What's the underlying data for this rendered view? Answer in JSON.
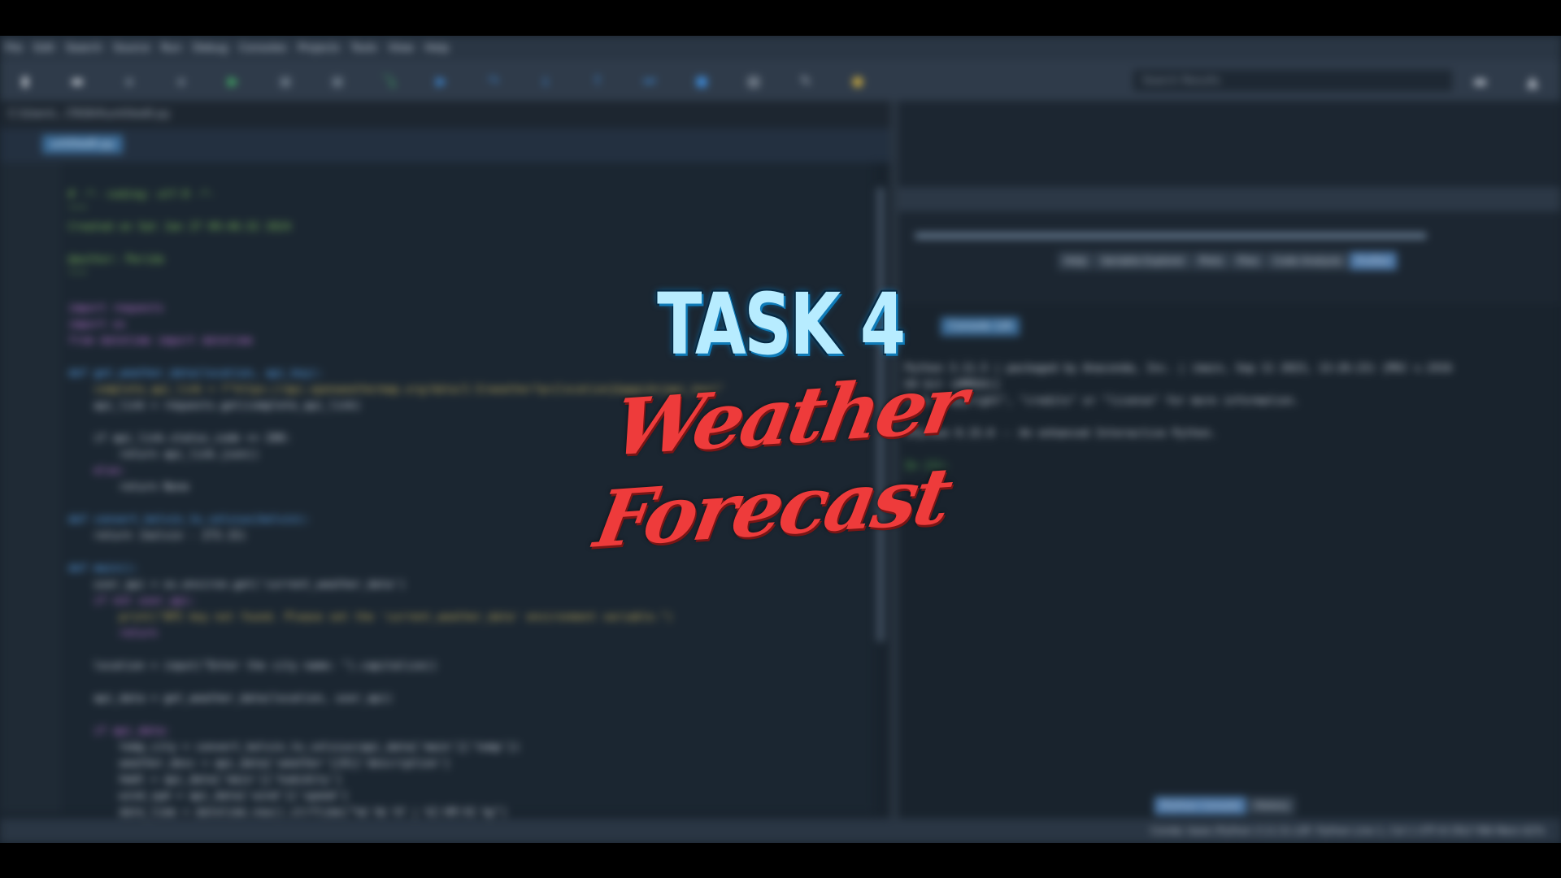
{
  "overlay": {
    "title": "TASK 4",
    "subtitle": "Weather Forecast"
  },
  "ide": {
    "menu": [
      "File",
      "Edit",
      "Search",
      "Source",
      "Run",
      "Debug",
      "Consoles",
      "Projects",
      "Tools",
      "View",
      "Help"
    ],
    "search_placeholder": "Search Results",
    "path": "C:\\Users\\...\\TASK4\\untitled0.py",
    "editor_tab": "untitled0.py",
    "code": [
      "# -*- coding: utf-8 -*-",
      "\"\"\"",
      "Created on Sat Jan 27 09:46:32 2024",
      "",
      "@author: Parida",
      "\"\"\"",
      "",
      "import requests",
      "import os",
      "from datetime import datetime",
      "",
      "def get_weather_data(location, api_key):",
      "    complete_api_link = f\"https://api.openweathermap.org/data/2.5/weather?q={location}&appid={api_key}\"",
      "    api_link = requests.get(complete_api_link)",
      "",
      "    if api_link.status_code == 200:",
      "        return api_link.json()",
      "    else:",
      "        return None",
      "",
      "def convert_kelvin_to_celsius(kelvin):",
      "    return (kelvin - 273.15)",
      "",
      "def main():",
      "    user_api = os.environ.get('current_weather_data')",
      "    if not user_api:",
      "        print(\"API key not found. Please set the 'current_weather_data' environment variable.\")",
      "        return",
      "",
      "    location = input(\"Enter the city name: \").capitalize()",
      "",
      "    api_data = get_weather_data(location, user_api)",
      "",
      "    if api_data:",
      "        temp_city = convert_kelvin_to_celsius(api_data['main']['temp'])",
      "        weather_desc = api_data['weather'][0]['description']",
      "        hmdt = api_data['main']['humidity']",
      "        wind_spd = api_data['wind']['speed']",
      "        date_time = datetime.now().strftime(\"%d %b %Y | %I:%M:%S %p\")"
    ],
    "pane_tabs": [
      "Help",
      "Variable Explorer",
      "Plots",
      "Files",
      "Code Analysis",
      "Profiler"
    ],
    "console_tab": "Console 1/A",
    "console_text": [
      "Python 3.11.5 | packaged by Anaconda, Inc. | (main, Sep 11 2023, 13:26:23) [MSC v.1916",
      "64 bit (AMD64)]",
      "Type \"copyright\", \"credits\" or \"license\" for more information.",
      "",
      "IPython 8.15.0 -- An enhanced Interactive Python.",
      "",
      "In [1]:"
    ],
    "console_bottom_tabs": [
      "IPython Console",
      "History"
    ],
    "status": "Conda: base (Python 3.11.5)   LSP: Python   Line 1, Col 1   UTF-8   CRLF   RW   Mem 62%"
  }
}
